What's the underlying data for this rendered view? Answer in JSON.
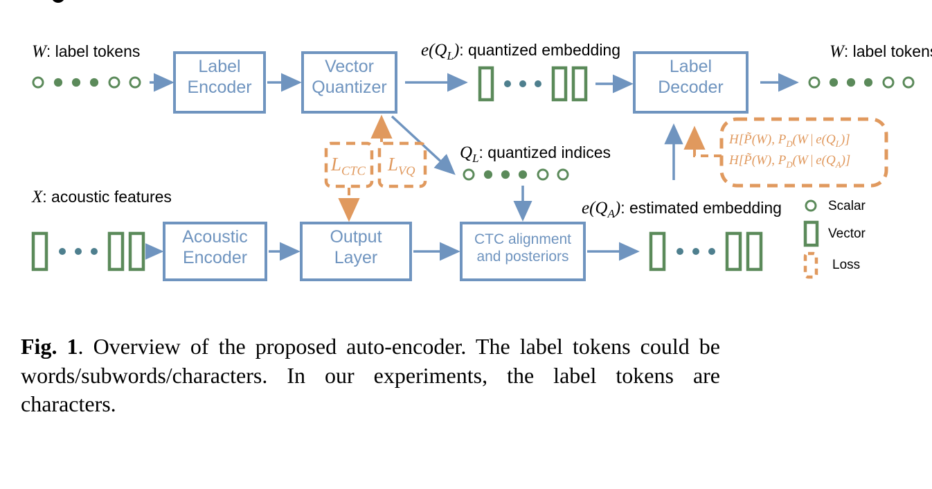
{
  "figure": {
    "caption_label": "Fig. 1",
    "caption_text": ". Overview of the proposed auto-encoder. The label tokens could be words/subwords/characters. In our experiments, the label tokens are characters."
  },
  "blocks": [
    {
      "id": "label-encoder",
      "line1": "Label",
      "line2": "Encoder"
    },
    {
      "id": "vector-quantizer",
      "line1": "Vector",
      "line2": "Quantizer"
    },
    {
      "id": "label-decoder",
      "line1": "Label",
      "line2": "Decoder"
    },
    {
      "id": "acoustic-encoder",
      "line1": "Acoustic",
      "line2": "Encoder"
    },
    {
      "id": "output-layer",
      "line1": "Output",
      "line2": "Layer"
    },
    {
      "id": "ctc-alignment",
      "line1": "CTC alignment",
      "line2": "and posteriors"
    }
  ],
  "annotations": {
    "w_label_tokens_in": {
      "sym": "W",
      "text": ": label tokens"
    },
    "w_label_tokens_out": {
      "sym": "W",
      "text": ": label tokens"
    },
    "eql_quantized_embedding": {
      "sym": "e(Q",
      "sub": "L",
      "tail": ")",
      "text": ": quantized embedding"
    },
    "ql_quantized_indices": {
      "sym": "Q",
      "sub": "L",
      "text": ": quantized indices"
    },
    "x_acoustic_features": {
      "sym": "X",
      "text": ": acoustic features"
    },
    "eqa_estimated_embedding": {
      "sym": "e(Q",
      "sub": "A",
      "tail": ")",
      "text": ": estimated embedding"
    }
  },
  "losses": {
    "ctc": {
      "sym": "L",
      "sub": "CTC"
    },
    "vq": {
      "sym": "L",
      "sub": "VQ"
    },
    "decoder_line1": "H[P̃(W), P_D(W | e(Q_L)]",
    "decoder_line2": "H[P̃(W), P_D(W | e(Q_A)]"
  },
  "legend": [
    {
      "id": "scalar",
      "label": "Scalar",
      "glyph": "circle-outline-icon"
    },
    {
      "id": "vector",
      "label": "Vector",
      "glyph": "rectangle-outline-icon"
    },
    {
      "id": "loss",
      "label": "Loss",
      "glyph": "dashed-rectangle-icon"
    }
  ],
  "colors": {
    "blue": "#6f94bf",
    "green": "#5b8a5a",
    "orange": "#e0995e",
    "dot_blue_green": "#4e7f8e",
    "black": "#000000"
  },
  "token_rows": {
    "input_tokens": [
      "hollow",
      "filled",
      "filled",
      "filled",
      "hollow",
      "hollow"
    ],
    "output_tokens": [
      "hollow",
      "filled",
      "filled",
      "filled",
      "hollow",
      "hollow"
    ],
    "quantized_indices": [
      "hollow",
      "filled",
      "filled",
      "filled",
      "hollow",
      "hollow"
    ]
  },
  "vector_rows": {
    "pattern": [
      "vector",
      "dot",
      "dot",
      "dot",
      "vector",
      "vector"
    ]
  }
}
